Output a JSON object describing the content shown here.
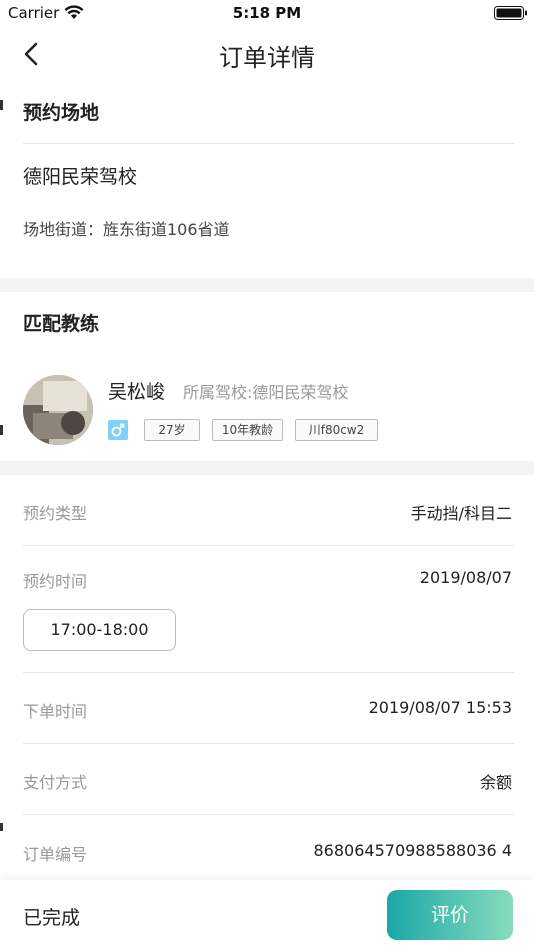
{
  "status_bar": {
    "carrier": "Carrier",
    "time": "5:18 PM"
  },
  "nav": {
    "title": "订单详情"
  },
  "venue": {
    "title": "预约场地",
    "name": "德阳民荣驾校",
    "address": "场地街道：旌东街道106省道"
  },
  "coach": {
    "title": "匹配教练",
    "name": "吴松峻",
    "school": "所属驾校:德阳民荣驾校",
    "gender_icon": "male-icon",
    "tags": [
      "27岁",
      "10年教龄",
      "川f80cw2"
    ]
  },
  "details": {
    "type_label": "预约类型",
    "type_value": "手动挡/科目二",
    "time_label": "预约时间",
    "time_value": "2019/08/07",
    "time_slot": "17:00-18:00",
    "order_time_label": "下单时间",
    "order_time_value": "2019/08/07 15:53",
    "payment_label": "支付方式",
    "payment_value": "余额",
    "order_no_label": "订单编号",
    "order_no_value": "868064570988588036 4"
  },
  "bottom": {
    "status": "已完成",
    "review_label": "评价"
  },
  "colors": {
    "accent_start": "#1aa7a7",
    "accent_end": "#88dcbc",
    "highlight": "#7fdcc4"
  }
}
